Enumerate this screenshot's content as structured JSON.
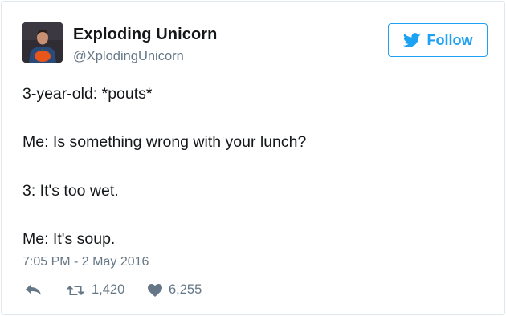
{
  "user": {
    "display_name": "Exploding Unicorn",
    "handle": "@XplodingUnicorn"
  },
  "follow_button": {
    "label": "Follow",
    "icon": "twitter-bird-icon"
  },
  "tweet": {
    "lines": [
      "3-year-old: *pouts*",
      "Me: Is something wrong with your lunch?",
      "3: It's too wet.",
      "Me: It's soup."
    ],
    "timestamp": "7:05 PM - 2 May 2016"
  },
  "actions": {
    "reply_icon": "reply-icon",
    "retweet_icon": "retweet-icon",
    "retweet_count": "1,420",
    "like_icon": "heart-icon",
    "like_count": "6,255"
  },
  "colors": {
    "accent": "#1da1f2",
    "text": "#14171a",
    "muted": "#657786",
    "border": "#e1e8ed"
  }
}
